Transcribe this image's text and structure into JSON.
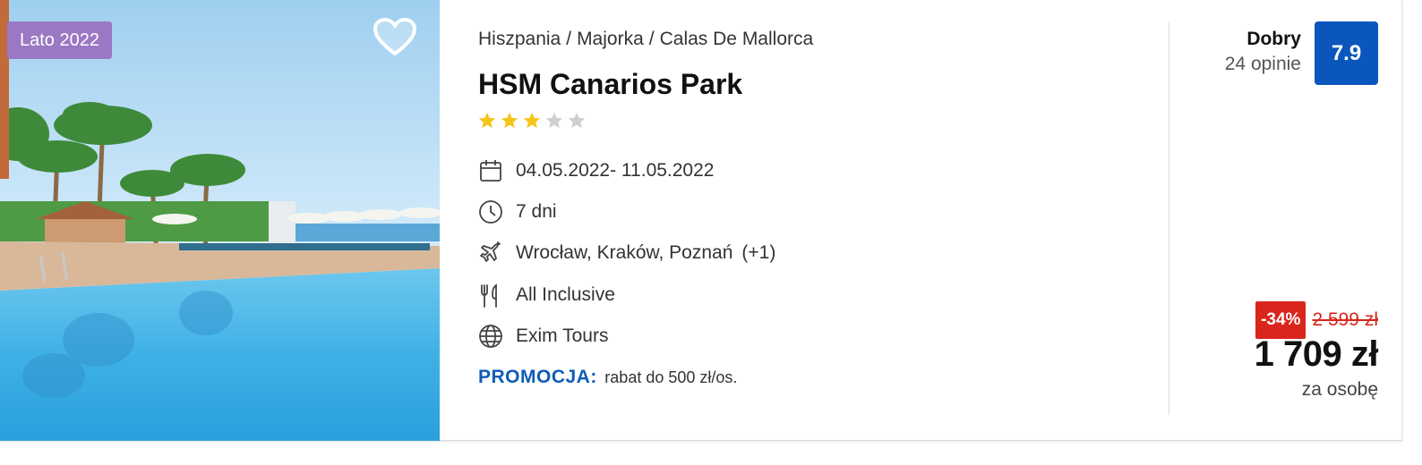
{
  "photo": {
    "season_badge": "Lato 2022",
    "favorite_icon": "heart-icon"
  },
  "hotel": {
    "breadcrumb": [
      "Hiszpania",
      "Majorka",
      "Calas De Mallorca"
    ],
    "breadcrumb_separator": "/",
    "name": "HSM Canarios Park",
    "stars": {
      "filled": 3,
      "total": 5
    },
    "dates": "04.05.2022- 11.05.2022",
    "duration": "7 dni",
    "departure": "Wrocław, Kraków, Poznań",
    "departure_more": "(+1)",
    "board": "All Inclusive",
    "operator": "Exim Tours",
    "promo_label": "PROMOCJA:",
    "promo_text": "rabat do 500 zł/os."
  },
  "icons": {
    "dates": "calendar-icon",
    "duration": "clock-icon",
    "departure": "plane-icon",
    "board": "fork-knife-icon",
    "operator": "globe-icon"
  },
  "rating": {
    "label": "Dobry",
    "reviews": "24 opinie",
    "score": "7.9"
  },
  "price": {
    "discount": "-34%",
    "old_price": "2 599 zł",
    "current": "1 709 zł",
    "per": "za osobę"
  },
  "colors": {
    "badge": "#9a78c4",
    "score_bg": "#0b56bd",
    "promo": "#0e5cb8",
    "discount": "#d9251b",
    "star_filled": "#f5c518",
    "star_empty": "#cfcfcf"
  }
}
